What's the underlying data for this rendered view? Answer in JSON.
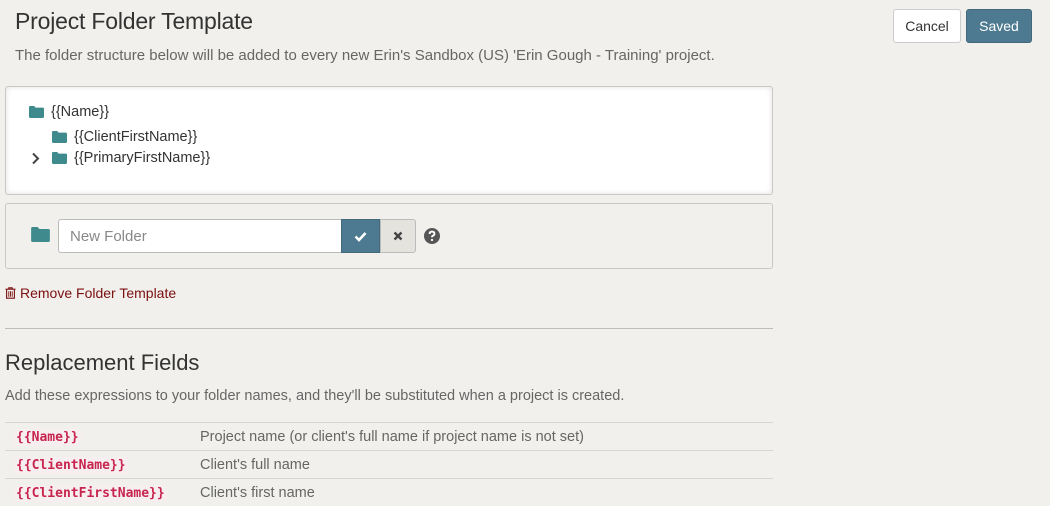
{
  "header": {
    "title": "Project Folder Template",
    "subtitle": "The folder structure below will be added to every new Erin's Sandbox (US) 'Erin Gough - Training' project.",
    "cancel_label": "Cancel",
    "saved_label": "Saved"
  },
  "tree": {
    "root": "{{Name}}",
    "children": [
      "{{ClientFirstName}}",
      "{{PrimaryFirstName}}"
    ]
  },
  "add_folder": {
    "placeholder": "New Folder"
  },
  "remove_label": "Remove Folder Template",
  "replacement": {
    "title": "Replacement Fields",
    "description": "Add these expressions to your folder names, and they'll be substituted when a project is created.",
    "rows": [
      {
        "code": "{{Name}}",
        "desc": "Project name (or client's full name if project name is not set)"
      },
      {
        "code": "{{ClientName}}",
        "desc": "Client's full name"
      },
      {
        "code": "{{ClientFirstName}}",
        "desc": "Client's first name"
      }
    ]
  },
  "colors": {
    "accent": "#4e7a91",
    "folder": "#3f8a8c",
    "danger": "#7a1010",
    "code": "#c7254e"
  }
}
